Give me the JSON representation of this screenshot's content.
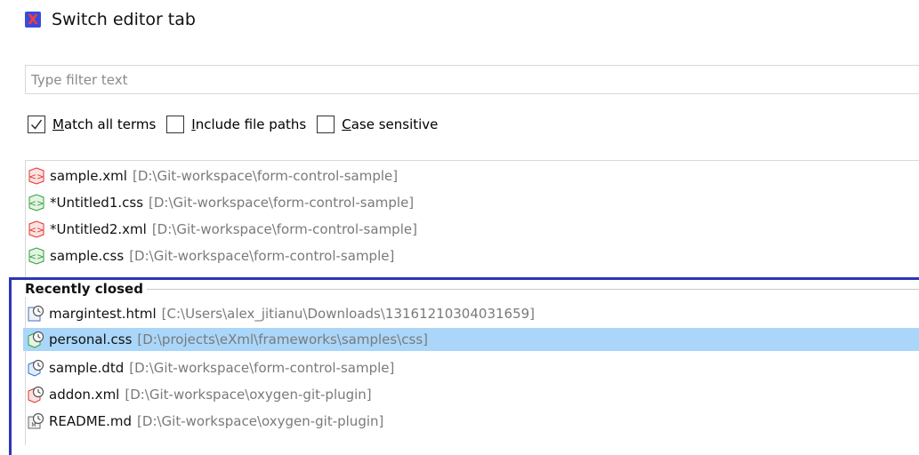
{
  "window": {
    "title": "Switch editor tab",
    "icon": "app-logo-icon"
  },
  "filter": {
    "placeholder": "Type filter text",
    "value": ""
  },
  "options": [
    {
      "label": "Match all terms",
      "checked": true
    },
    {
      "label": "Include file paths",
      "checked": false
    },
    {
      "label": "Case sensitive",
      "checked": false
    }
  ],
  "open_editors": [
    {
      "name": "sample.xml",
      "path": "[D:\\Git-workspace\\form-control-sample]",
      "icon": "xml-file-icon"
    },
    {
      "name": "*Untitled1.css",
      "path": "[D:\\Git-workspace\\form-control-sample]",
      "icon": "css-file-icon"
    },
    {
      "name": "*Untitled2.xml",
      "path": "[D:\\Git-workspace\\form-control-sample]",
      "icon": "xml-file-icon"
    },
    {
      "name": "sample.css",
      "path": "[D:\\Git-workspace\\form-control-sample]",
      "icon": "css-file-icon"
    }
  ],
  "recently_closed": {
    "label": "Recently closed",
    "items": [
      {
        "name": "margintest.html",
        "path": "[C:\\Users\\alex_jitianu\\Downloads\\13161210304031659]",
        "icon": "html-file-history-icon",
        "selected": false
      },
      {
        "name": "personal.css",
        "path": "[D:\\projects\\eXml\\frameworks\\samples\\css]",
        "icon": "css-file-history-icon",
        "selected": true
      },
      {
        "name": "sample.dtd",
        "path": "[D:\\Git-workspace\\form-control-sample]",
        "icon": "dtd-file-history-icon",
        "selected": false
      },
      {
        "name": "addon.xml",
        "path": "[D:\\Git-workspace\\oxygen-git-plugin]",
        "icon": "xml-file-history-icon",
        "selected": false
      },
      {
        "name": "README.md",
        "path": "[D:\\Git-workspace\\oxygen-git-plugin]",
        "icon": "md-file-history-icon",
        "selected": false
      }
    ]
  },
  "colors": {
    "selection": "#aad6fa",
    "highlight_border": "#2d35b8",
    "xml_icon": "#e0302a",
    "css_icon": "#2f9e3a",
    "dtd_icon": "#2b6fd6"
  }
}
